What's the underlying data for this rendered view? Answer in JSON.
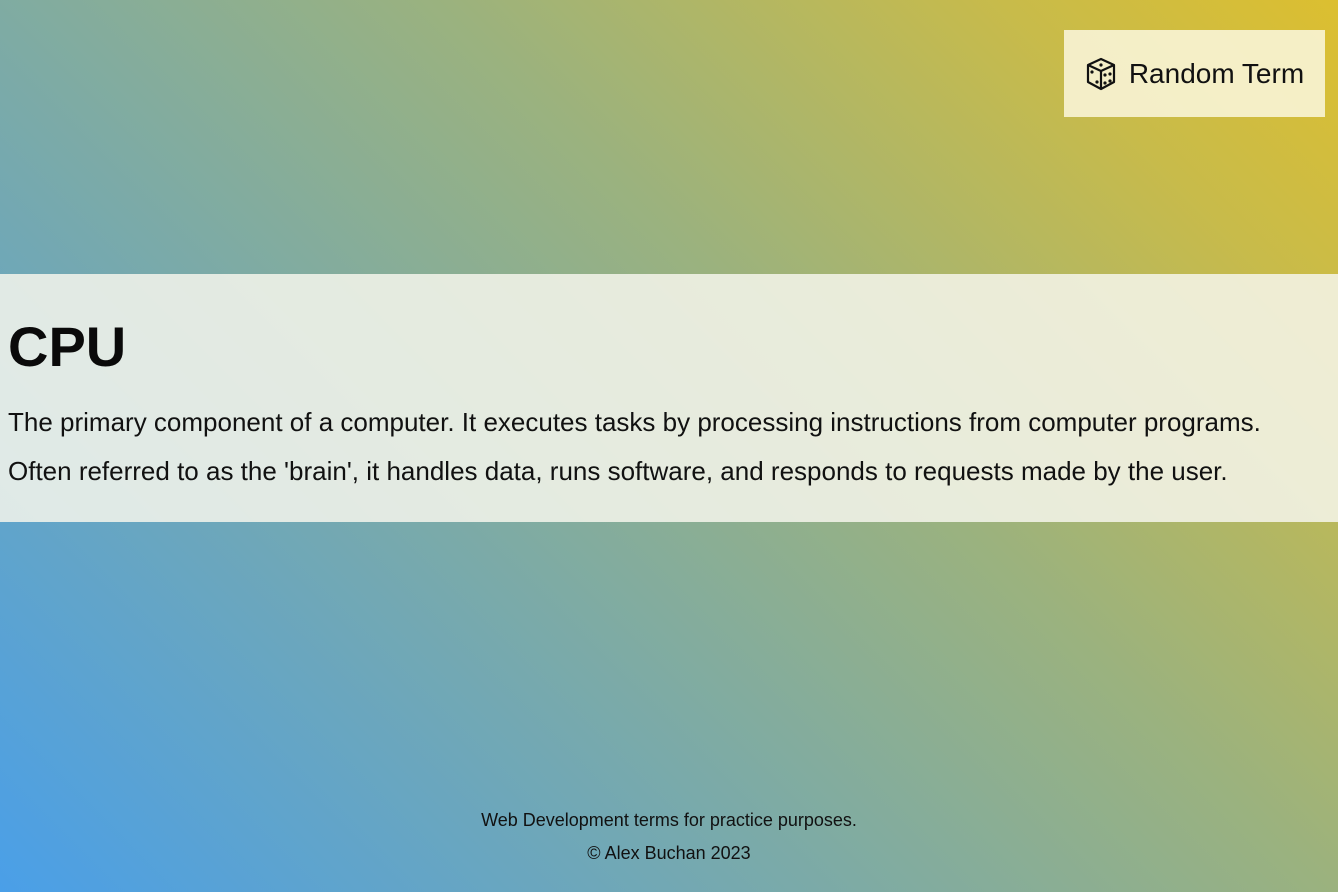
{
  "header": {
    "random_button": {
      "label": "Random Term",
      "icon": "dice-icon"
    }
  },
  "term": {
    "title": "CPU",
    "description_line1": "The primary component of a computer. It executes tasks by processing instructions from computer programs.",
    "description_line2": "Often referred to as the 'brain', it handles data, runs software, and responds to requests made by the user."
  },
  "footer": {
    "tagline": "Web Development terms for practice purposes.",
    "copyright": "© Alex Buchan 2023"
  },
  "colors": {
    "gradient_start": "#4a9fe8",
    "gradient_end": "#dcbf30",
    "panel_background": "#f6f6ec"
  }
}
